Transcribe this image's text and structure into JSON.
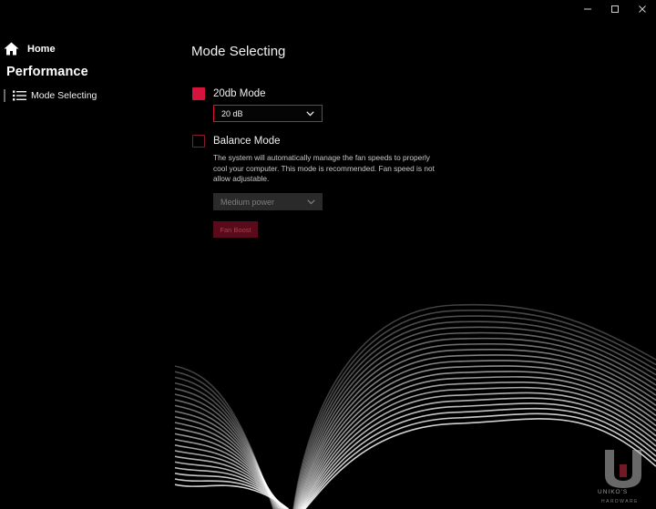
{
  "window": {
    "controls": [
      {
        "name": "minimize",
        "glyph": "—"
      },
      {
        "name": "maximize",
        "glyph": "☐"
      },
      {
        "name": "close",
        "glyph": "✕"
      }
    ]
  },
  "sidebar": {
    "home_label": "Home",
    "section_title": "Performance",
    "items": [
      {
        "label": "Mode Selecting",
        "icon": "list-icon"
      }
    ]
  },
  "main": {
    "title": "Mode Selecting",
    "options": [
      {
        "label": "20db Mode",
        "checked": true,
        "select_value": "20 dB"
      },
      {
        "label": "Balance Mode",
        "checked": false,
        "description": "The system will automatically manage the fan speeds to properly cool your computer.  This mode is recommended. Fan speed is not allow adjustable.",
        "select_value": "Medium power"
      }
    ],
    "fan_boost_label": "Fan Boost"
  },
  "watermark": {
    "text": "UNIKO'S",
    "subtext": "HARDWARE"
  },
  "colors": {
    "accent": "#d4143c",
    "background": "#000000",
    "disabled_fill": "#2a2a2a"
  }
}
